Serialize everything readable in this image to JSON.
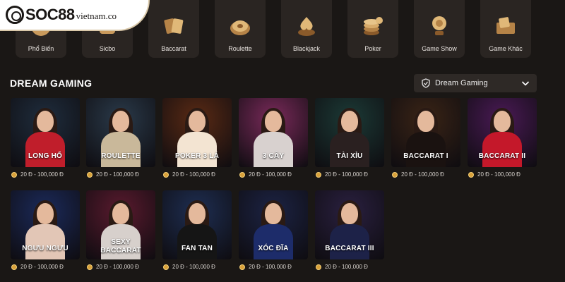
{
  "brand": {
    "name": "SOC88",
    "domain": "vietnam.co"
  },
  "categories": [
    {
      "label": "Phổ Biến",
      "icon": "flame-icon"
    },
    {
      "label": "Sicbo",
      "icon": "dice-icon"
    },
    {
      "label": "Baccarat",
      "icon": "cards-icon"
    },
    {
      "label": "Roulette",
      "icon": "roulette-icon"
    },
    {
      "label": "Blackjack",
      "icon": "spade-icon"
    },
    {
      "label": "Poker",
      "icon": "chips-icon"
    },
    {
      "label": "Game Show",
      "icon": "microphone-icon"
    },
    {
      "label": "Game Khác",
      "icon": "box-icon"
    }
  ],
  "section": {
    "title": "DREAM GAMING"
  },
  "provider_select": {
    "value": "Dream Gaming"
  },
  "games": [
    {
      "name": "LONG HỔ",
      "price": "20 Đ - 100,000 Đ",
      "bg": "#1f2d3d",
      "dress": "#c01e2b"
    },
    {
      "name": "ROULETTE",
      "price": "20 Đ - 100,000 Đ",
      "bg": "#2a3a4a",
      "dress": "#c9b89a"
    },
    {
      "name": "POKER 3 LÁ",
      "price": "20 Đ - 100,000 Đ",
      "bg": "#5a2a14",
      "dress": "#f3e4d2"
    },
    {
      "name": "3 CÂY",
      "price": "20 Đ - 100,000 Đ",
      "bg": "#7a2a5a",
      "dress": "#d8d1cf"
    },
    {
      "name": "TÀI XỈU",
      "price": "20 Đ - 100,000 Đ",
      "bg": "#1c3a36",
      "dress": "#2a2020"
    },
    {
      "name": "BACCARAT I",
      "price": "20 Đ - 100,000 Đ",
      "bg": "#3a2416",
      "dress": "#1a1210"
    },
    {
      "name": "BACCARAT II",
      "price": "20 Đ - 100,000 Đ",
      "bg": "#4a1a55",
      "dress": "#c4182a"
    },
    {
      "name": "NGƯU NGƯU",
      "price": "20 Đ - 100,000 Đ",
      "bg": "#1b2a5a",
      "dress": "#e2c6b6"
    },
    {
      "name": "SEXY BACCARAT",
      "price": "20 Đ - 100,000 Đ",
      "bg": "#5a1a2e",
      "dress": "#d7d0cc"
    },
    {
      "name": "FAN TAN",
      "price": "20 Đ - 100,000 Đ",
      "bg": "#1e2e52",
      "dress": "#151515"
    },
    {
      "name": "XÓC ĐĨA",
      "price": "20 Đ - 100,000 Đ",
      "bg": "#1c2344",
      "dress": "#1d2c6a"
    },
    {
      "name": "BACCARAT III",
      "price": "20 Đ - 100,000 Đ",
      "bg": "#2a2040",
      "dress": "#1d2248"
    }
  ]
}
